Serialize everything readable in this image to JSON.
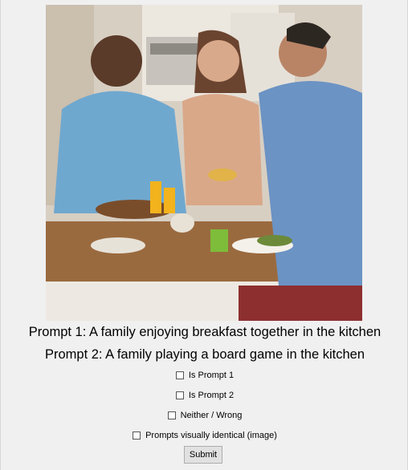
{
  "image": {
    "description_icon": "photo-icon"
  },
  "prompts": {
    "prompt1": "Prompt 1: A family enjoying breakfast together in the kitchen",
    "prompt2": "Prompt 2: A family playing a board game in the kitchen"
  },
  "options": {
    "is_prompt_1": "Is Prompt 1",
    "is_prompt_2": "Is Prompt 2",
    "neither": "Neither / Wrong",
    "identical": "Prompts visually identical (image)"
  },
  "submit_label": "Submit",
  "colors": {
    "background": "#f0f0f0",
    "button_face": "#e1e1e1",
    "button_border": "#adadad"
  }
}
